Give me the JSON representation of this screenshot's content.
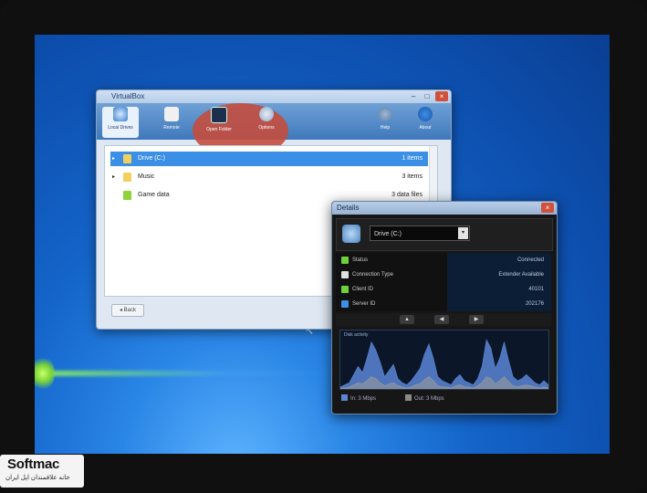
{
  "explorer": {
    "title": "VirtualBox",
    "controls": [
      "–",
      "□",
      "×"
    ],
    "toolbar": [
      {
        "label": "Local Drives",
        "icon": "drive-icon"
      },
      {
        "label": "Remote",
        "icon": "remote-icon"
      },
      {
        "label": "Open Folder",
        "icon": "folder-icon"
      },
      {
        "label": "Options",
        "icon": "options-icon"
      },
      {
        "label": "Help",
        "icon": "help-icon"
      },
      {
        "label": "About",
        "icon": "info-icon"
      }
    ],
    "rows": [
      {
        "name": "Drive (C:)",
        "size": "1 items",
        "caret": "▸",
        "selected": true,
        "color": "#f2d060"
      },
      {
        "name": "Music",
        "size": "3 items",
        "caret": "▸",
        "selected": false,
        "color": "#f2d060"
      },
      {
        "name": "Game data",
        "size": "3 data files",
        "caret": "",
        "selected": false,
        "color": "#8ed23c"
      }
    ],
    "back_label": "◂ Back"
  },
  "details": {
    "title": "Details",
    "close": "×",
    "selected_drive": "Drive (C:)",
    "dropdown_glyph": "▾",
    "properties": [
      {
        "key": "Status",
        "value": "Connected",
        "color": "#6fd13a"
      },
      {
        "key": "Connection Type",
        "value": "Extender Available",
        "color": "#e0e0e0"
      },
      {
        "key": "Client ID",
        "value": "40101",
        "color": "#6fd13a"
      },
      {
        "key": "Server ID",
        "value": "202176",
        "color": "#3d8fe6"
      }
    ],
    "tools": [
      "▲",
      "◀",
      "▶"
    ],
    "graph_title": "Disk activity",
    "legend": [
      {
        "label": "In: 3 Mbps",
        "color": "#5b86d6"
      },
      {
        "label": "Out: 3 Mbps",
        "color": "#8a8a8a"
      }
    ]
  },
  "graph_data": {
    "in": [
      2,
      4,
      6,
      14,
      22,
      16,
      30,
      46,
      38,
      26,
      12,
      18,
      24,
      10,
      6,
      4,
      8,
      14,
      20,
      34,
      44,
      30,
      12,
      8,
      6,
      4,
      10,
      14,
      8,
      6,
      4,
      10,
      22,
      48,
      40,
      20,
      30,
      46,
      28,
      12,
      8,
      10,
      14,
      10,
      6,
      4,
      8,
      4
    ],
    "out": [
      1,
      1,
      2,
      4,
      6,
      5,
      8,
      12,
      10,
      6,
      3,
      5,
      6,
      3,
      2,
      1,
      2,
      4,
      5,
      9,
      12,
      8,
      3,
      2,
      2,
      1,
      3,
      4,
      2,
      2,
      1,
      3,
      6,
      12,
      10,
      5,
      8,
      12,
      7,
      3,
      2,
      3,
      4,
      3,
      2,
      1,
      2,
      1
    ]
  },
  "watermark": {
    "brand": "Softmac",
    "tagline": "خانه علاقمندان اپل ایران"
  }
}
